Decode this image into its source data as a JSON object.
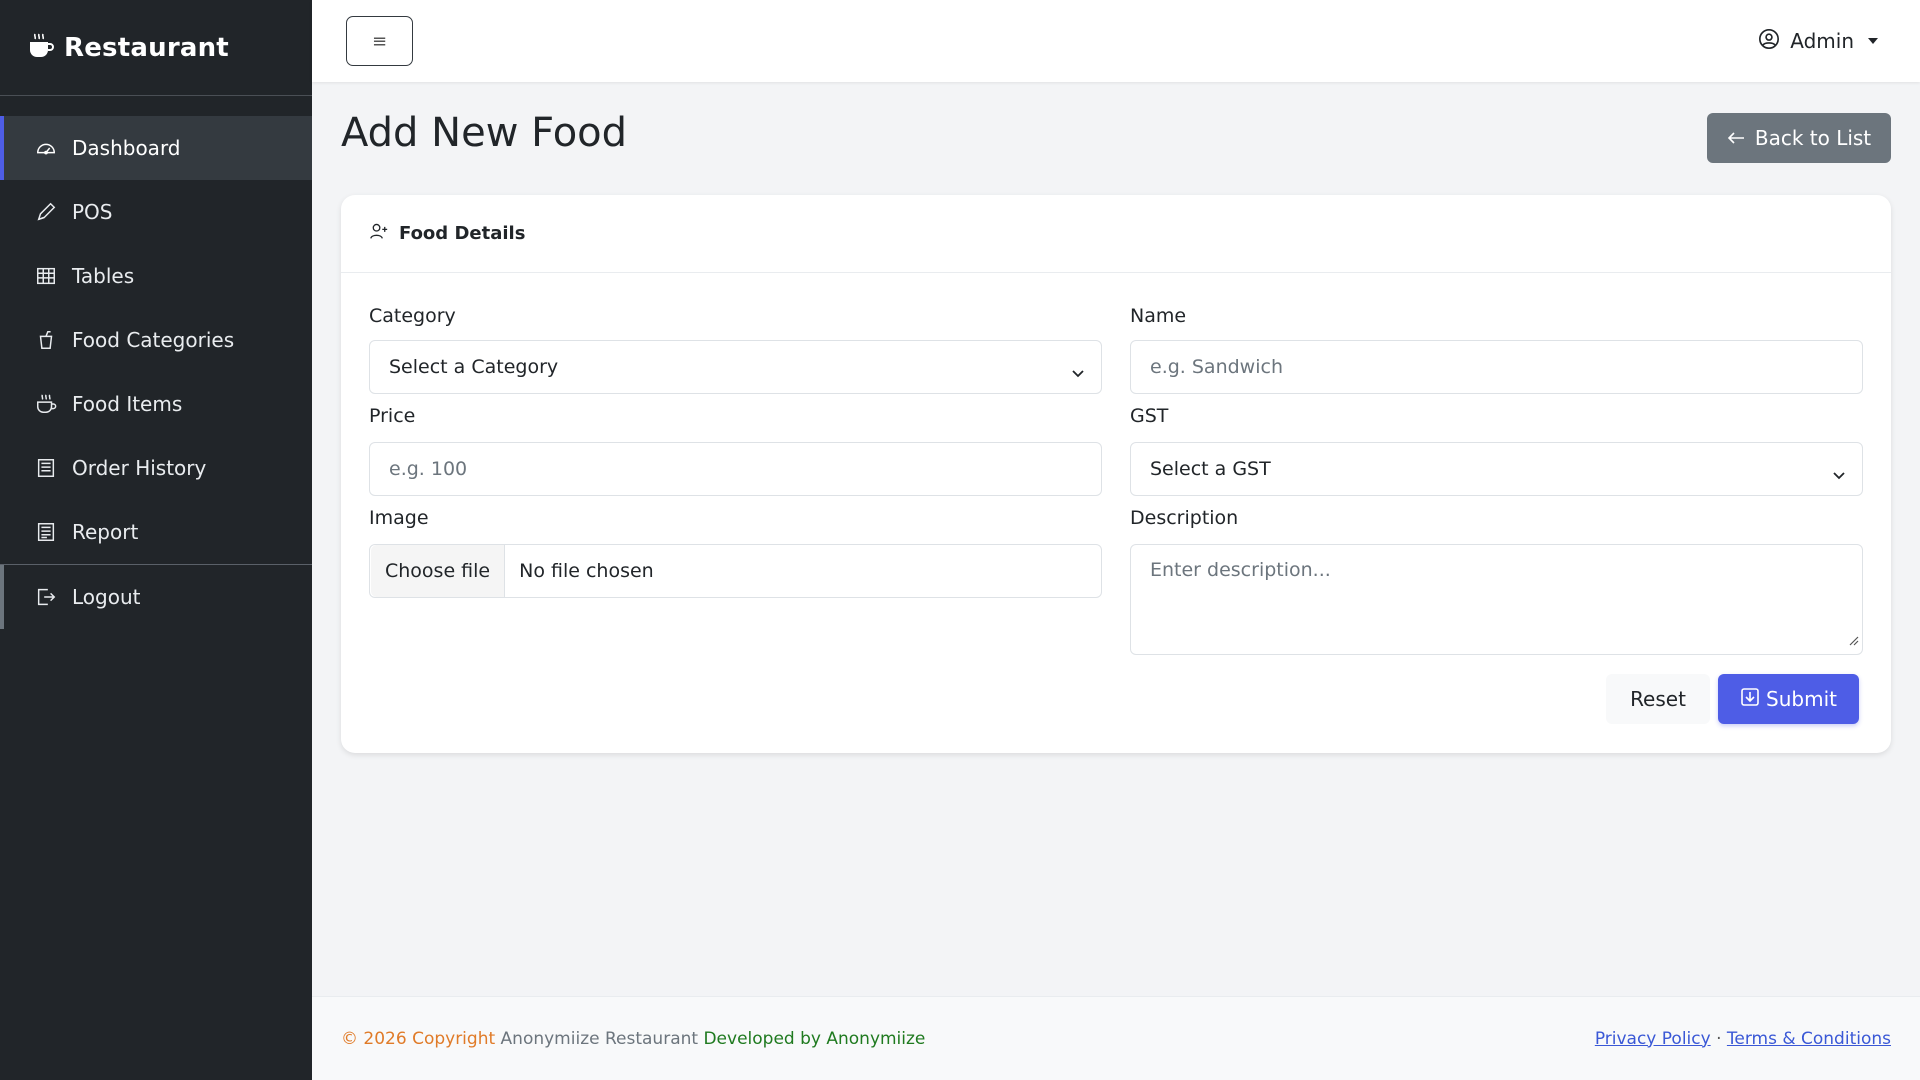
{
  "sidebar": {
    "brand": "Restaurant",
    "items": [
      {
        "label": "Dashboard",
        "icon": "gauge-icon",
        "active": true
      },
      {
        "label": "POS",
        "icon": "pencil-icon"
      },
      {
        "label": "Tables",
        "icon": "table-grid-icon"
      },
      {
        "label": "Food Categories",
        "icon": "cup-icon"
      },
      {
        "label": "Food Items",
        "icon": "hot-cup-icon"
      },
      {
        "label": "Order History",
        "icon": "receipt-icon"
      },
      {
        "label": "Report",
        "icon": "report-icon"
      }
    ],
    "logout": "Logout"
  },
  "topbar": {
    "toggle": "≡",
    "user": "Admin"
  },
  "main": {
    "title": "Add New Food",
    "back_label": "Back to List",
    "card_title": "Food Details",
    "form": {
      "category_label": "Category",
      "category_value": "Select a Category",
      "name_label": "Name",
      "name_placeholder": "e.g. Sandwich",
      "price_label": "Price",
      "price_placeholder": "e.g. 100",
      "gst_label": "GST",
      "gst_value": "Select a GST",
      "image_label": "Image",
      "file_button": "Choose file",
      "file_status": "No file chosen",
      "description_label": "Description",
      "description_placeholder": "Enter description..."
    },
    "reset_label": "Reset",
    "submit_label": "Submit"
  },
  "footer": {
    "copyright": "© 2026 Copyright",
    "brand": "Anonymiize Restaurant",
    "developed": "Developed by Anonymiize",
    "privacy": "Privacy Policy",
    "separator": "·",
    "terms": "Terms & Conditions"
  },
  "colors": {
    "sidebar_bg": "#212529",
    "accent": "#4e5de6",
    "secondary": "#6c757d"
  }
}
